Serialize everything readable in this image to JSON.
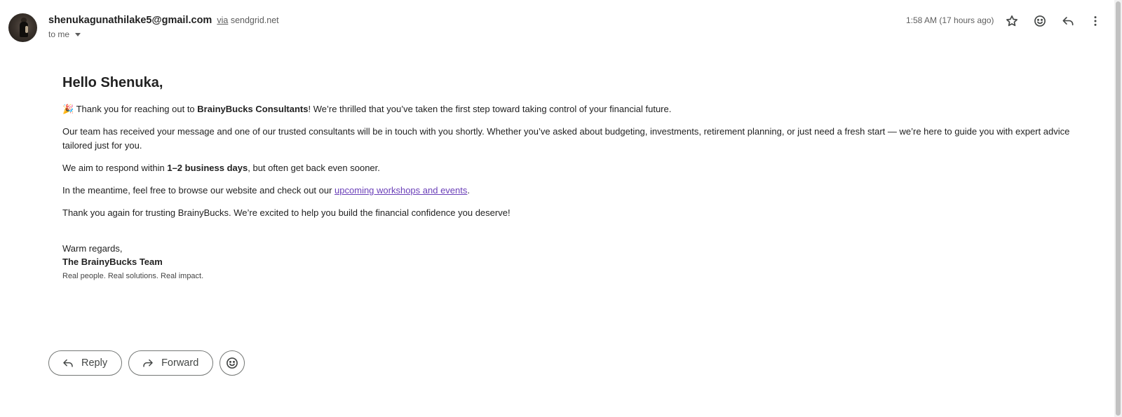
{
  "header": {
    "sender_email": "shenukagunathilake5@gmail.com",
    "via_label": "via",
    "via_domain": "sendgrid.net",
    "to_label": "to me",
    "timestamp": "1:58 AM (17 hours ago)",
    "icons": [
      "star-icon",
      "emoji-icon",
      "reply-icon",
      "more-vert-icon"
    ]
  },
  "email": {
    "greeting": "Hello Shenuka,",
    "p1_emoji": "🎉",
    "p1_pre": " Thank you for reaching out to ",
    "p1_bold": "BrainyBucks Consultants",
    "p1_post": "! We’re thrilled that you’ve taken the first step toward taking control of your financial future.",
    "p2": "Our team has received your message and one of our trusted consultants will be in touch with you shortly. Whether you’ve asked about budgeting, investments, retirement planning, or just need a fresh start — we’re here to guide you with expert advice tailored just for you.",
    "p3_pre": "We aim to respond within ",
    "p3_bold": "1–2 business days",
    "p3_post": ", but often get back even sooner.",
    "p4_pre": "In the meantime, feel free to browse our website and check out our ",
    "p4_link": "upcoming workshops and events",
    "p4_post": ".",
    "p5": "Thank you again for trusting BrainyBucks. We’re excited to help you build the financial confidence you deserve!",
    "sig_regards": "Warm regards,",
    "sig_team": "The BrainyBucks Team",
    "sig_tagline": "Real people. Real solutions. Real impact."
  },
  "actions": {
    "reply_label": "Reply",
    "forward_label": "Forward"
  },
  "colors": {
    "link": "#6a3fb8",
    "text": "#222222",
    "muted": "#5e5e5e",
    "button_border": "#747775"
  }
}
